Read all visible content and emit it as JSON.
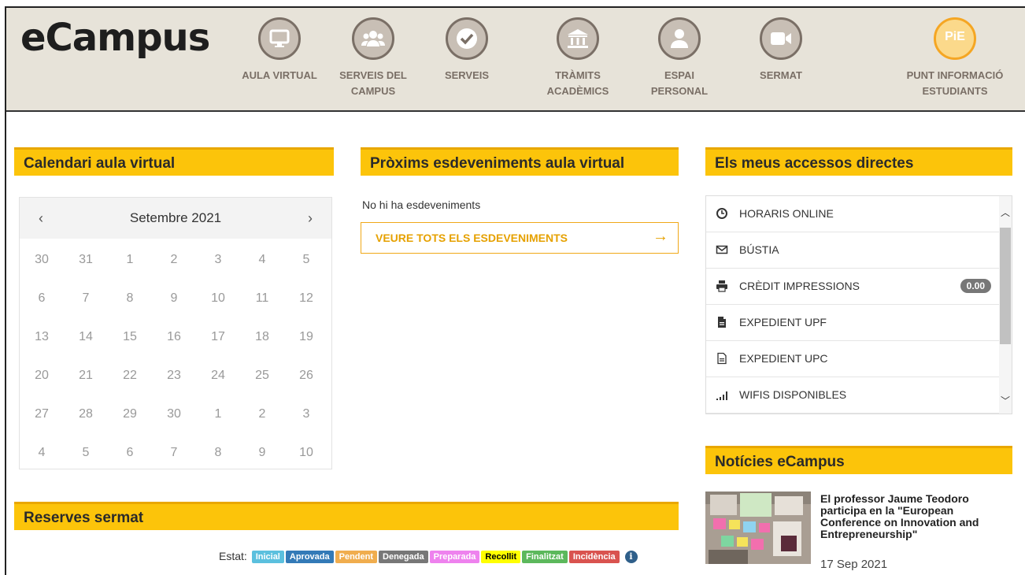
{
  "app": {
    "logo": "eCampus"
  },
  "nav": [
    {
      "label1": "AULA VIRTUAL",
      "label2": "",
      "icon": "monitor-icon"
    },
    {
      "label1": "SERVEIS DEL",
      "label2": "CAMPUS",
      "icon": "users-icon"
    },
    {
      "label1": "SERVEIS",
      "label2": "",
      "icon": "check-icon"
    },
    {
      "label1": "TRÀMITS",
      "label2": "ACADÈMICS",
      "icon": "building-icon"
    },
    {
      "label1": "ESPAI",
      "label2": "PERSONAL",
      "icon": "user-icon"
    },
    {
      "label1": "SERMAT",
      "label2": "",
      "icon": "video-camera-icon"
    },
    {
      "label1": "PUNT INFORMACIÓ",
      "label2": "ESTUDIANTS",
      "icon": "pie-icon",
      "icon_text": "PiE"
    }
  ],
  "calendar": {
    "heading": "Calendari aula virtual",
    "month": "Setembre 2021",
    "prev": "‹",
    "next": "›",
    "weeks": [
      [
        "30",
        "31",
        "1",
        "2",
        "3",
        "4",
        "5"
      ],
      [
        "6",
        "7",
        "8",
        "9",
        "10",
        "11",
        "12"
      ],
      [
        "13",
        "14",
        "15",
        "16",
        "17",
        "18",
        "19"
      ],
      [
        "20",
        "21",
        "22",
        "23",
        "24",
        "25",
        "26"
      ],
      [
        "27",
        "28",
        "29",
        "30",
        "1",
        "2",
        "3"
      ],
      [
        "4",
        "5",
        "6",
        "7",
        "8",
        "9",
        "10"
      ]
    ]
  },
  "events": {
    "heading": "Pròxims esdeveniments aula virtual",
    "empty": "No hi ha esdeveniments",
    "all_label": "VEURE TOTS ELS ESDEVENIMENTS",
    "arrow": "→"
  },
  "shortcuts": {
    "heading": "Els meus accessos directes",
    "items": [
      {
        "label": "HORARIS ONLINE",
        "icon": "clock-icon"
      },
      {
        "label": "BÚSTIA",
        "icon": "mail-icon"
      },
      {
        "label": "CRÈDIT IMPRESSIONS",
        "icon": "printer-icon",
        "badge": "0.00"
      },
      {
        "label": "EXPEDIENT UPF",
        "icon": "file-solid-icon"
      },
      {
        "label": "EXPEDIENT UPC",
        "icon": "file-outline-icon"
      },
      {
        "label": "WIFIS DISPONIBLES",
        "icon": "signal-icon"
      }
    ]
  },
  "news": {
    "heading": "Notícies eCampus",
    "title": "El professor Jaume Teodoro participa en la \"European Conference on Innovation and Entrepreneurship\"",
    "date": "17 Sep 2021"
  },
  "reserves": {
    "heading": "Reserves sermat",
    "status_label": "Estat:",
    "statuses": [
      {
        "label": "Inicial",
        "color": "#5bc0de",
        "text": "#ffffff"
      },
      {
        "label": "Aprovada",
        "color": "#337ab7",
        "text": "#ffffff"
      },
      {
        "label": "Pendent",
        "color": "#f0ad4e",
        "text": "#ffffff"
      },
      {
        "label": "Denegada",
        "color": "#777777",
        "text": "#ffffff"
      },
      {
        "label": "Preparada",
        "color": "#ee82ee",
        "text": "#ffffff"
      },
      {
        "label": "Recollit",
        "color": "#ffff00",
        "text": "#000000"
      },
      {
        "label": "Finalitzat",
        "color": "#5cb85c",
        "text": "#ffffff"
      },
      {
        "label": "Incidència",
        "color": "#d9534f",
        "text": "#ffffff"
      }
    ]
  },
  "colors": {
    "accent": "#fcc40a",
    "header_bg": "#e7e3d9",
    "nav": "#7a6f66"
  }
}
